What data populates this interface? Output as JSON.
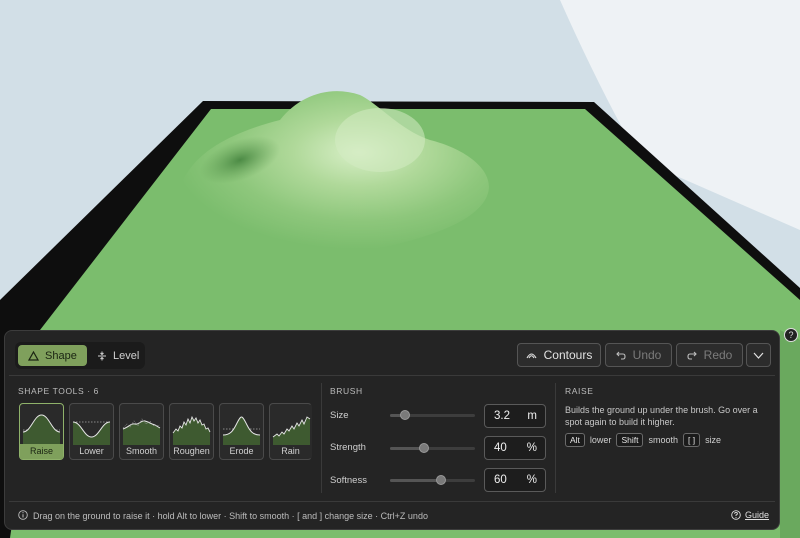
{
  "mode_tabs": [
    {
      "label": "Shape",
      "icon": "triangle-icon",
      "active": true
    },
    {
      "label": "Level",
      "icon": "level-icon",
      "active": false
    }
  ],
  "actions": {
    "contours": "Contours",
    "undo": "Undo",
    "redo": "Redo"
  },
  "shape_tools": {
    "title": "SHAPE TOOLS · 6",
    "items": [
      {
        "label": "Raise",
        "active": true
      },
      {
        "label": "Lower",
        "active": false
      },
      {
        "label": "Smooth",
        "active": false
      },
      {
        "label": "Roughen",
        "active": false
      },
      {
        "label": "Erode",
        "active": false
      },
      {
        "label": "Rain",
        "active": false
      }
    ]
  },
  "brush": {
    "title": "BRUSH",
    "size": {
      "label": "Size",
      "value": "3.2",
      "unit": "m",
      "level": 0.18
    },
    "strength": {
      "label": "Strength",
      "value": "40",
      "unit": "%",
      "level": 0.4
    },
    "softness": {
      "label": "Softness",
      "value": "60",
      "unit": "%",
      "level": 0.6
    }
  },
  "info": {
    "title": "RAISE",
    "description": "Builds the ground up under the brush. Go over a spot again to build it higher.",
    "key_alt": "Alt",
    "key_alt_desc": "lower",
    "key_shift": "Shift",
    "key_shift_desc": "smooth",
    "key_brackets": "[ ]",
    "key_brackets_desc": "size"
  },
  "footer": {
    "hint": "Drag on the ground to raise it · hold Alt to lower · Shift to smooth · [ and ] change size · Ctrl+Z undo",
    "guide": "Guide"
  },
  "colors": {
    "sky": "#d2dfe7",
    "grass": "#7bbd6d",
    "accent": "#7fa05c",
    "panel": "#242424"
  }
}
